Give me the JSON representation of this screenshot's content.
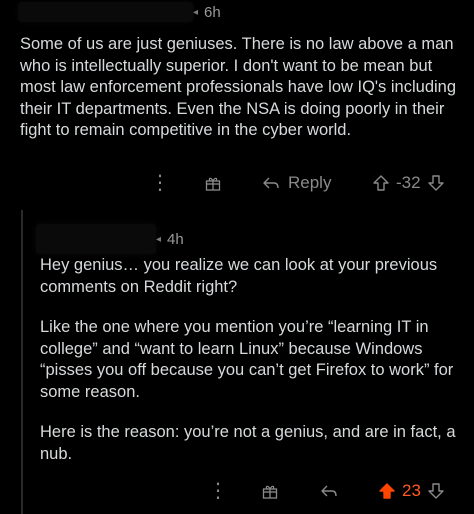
{
  "comments": [
    {
      "time": "6h",
      "body": [
        "Some of us are just geniuses. There is no law above a man who is intellectually superior. I don't want to be mean but most law enforcement professionals have low IQ's including their IT departments. Even the NSA is doing poorly in their fight to remain competitive in the cyber world."
      ],
      "actions": {
        "reply_label": "Reply",
        "score": "-32"
      }
    },
    {
      "time": "4h",
      "body": [
        "Hey genius… you realize we can look at your previous comments on Reddit right?",
        "Like the one where you mention you’re “learning IT in college” and “want to learn Linux” because Windows “pisses you off because you can’t get Firefox to work” for some reason.",
        "Here is the reason: you’re not a genius, and are in fact, a nub."
      ],
      "actions": {
        "score": "23"
      }
    }
  ],
  "colors": {
    "background": "#000000",
    "text": "#d7dadc",
    "muted": "#8a8a8a",
    "upvote": "#ff4500",
    "thread_line": "#2a2a2a"
  },
  "icons": [
    "more-dots-icon",
    "award-icon",
    "reply-arrow-icon",
    "upvote-icon",
    "downvote-icon"
  ]
}
